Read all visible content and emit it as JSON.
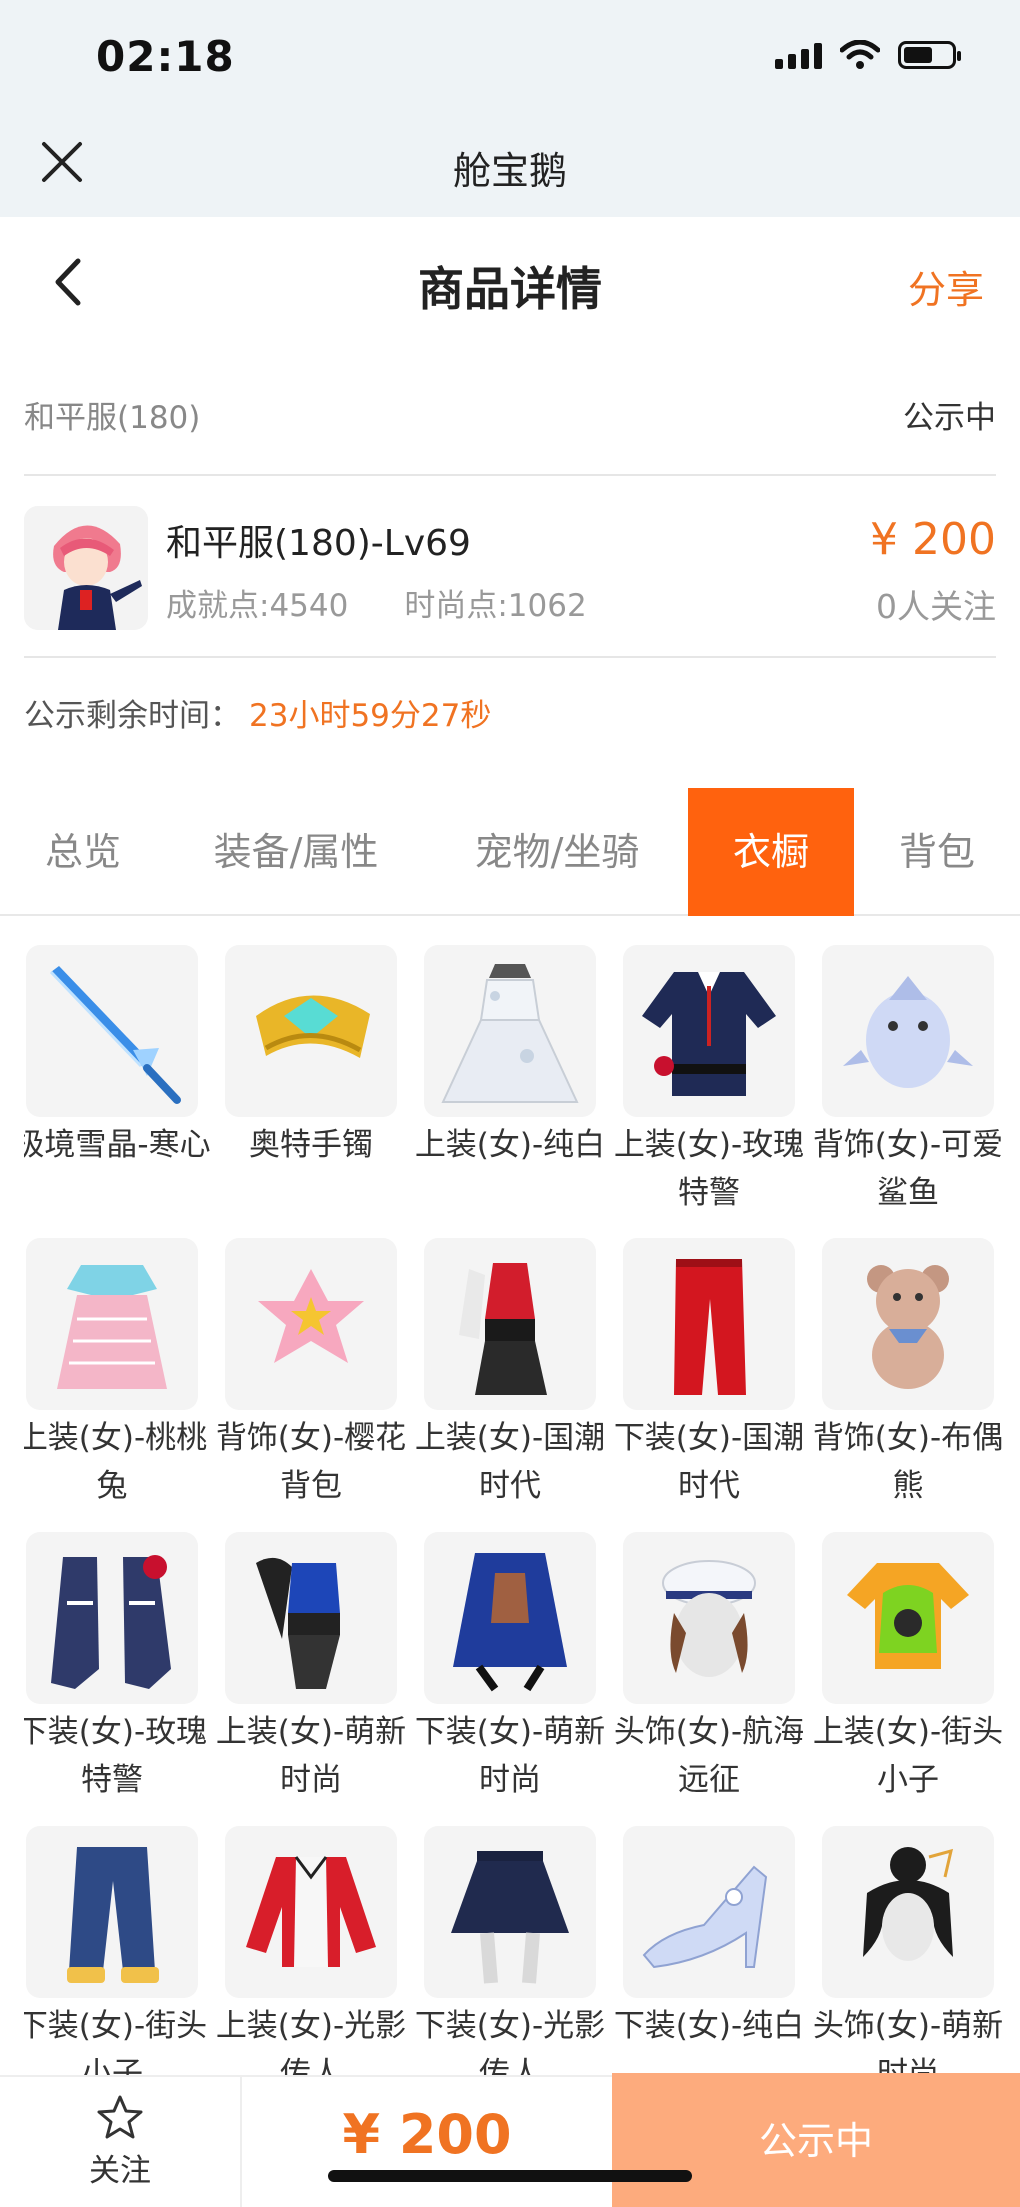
{
  "status_bar": {
    "time": "02:18",
    "battery_level": 0.6
  },
  "app": {
    "title": "舱宝鹅"
  },
  "header": {
    "title": "商品详情",
    "share_label": "分享"
  },
  "server_row": {
    "server": "和平服(180)",
    "state": "公示中"
  },
  "product": {
    "name": "和平服(180)-Lv69",
    "achievement": "成就点:4540",
    "fashion": "时尚点:1062",
    "price": "¥ 200",
    "followers": "0人关注"
  },
  "countdown": {
    "label": "公示剩余时间：",
    "value": "23小时59分27秒"
  },
  "tabs": [
    {
      "label": "总览",
      "active": false
    },
    {
      "label": "装备/属性",
      "active": false
    },
    {
      "label": "宠物/坐骑",
      "active": false
    },
    {
      "label": "衣橱",
      "active": true
    },
    {
      "label": "背包",
      "active": false
    }
  ],
  "wardrobe": [
    {
      "label": "极境雪晶-寒心",
      "icon": "ice-sword-icon"
    },
    {
      "label": "奥特手镯",
      "icon": "gold-bracelet-icon"
    },
    {
      "label": "上装(女)-纯白",
      "icon": "white-dress-icon"
    },
    {
      "label": "上装(女)-玫瑰特警",
      "icon": "police-jacket-icon"
    },
    {
      "label": "背饰(女)-可爱鲨鱼",
      "icon": "shark-backpack-icon"
    },
    {
      "label": "上装(女)-桃桃兔",
      "icon": "pink-dress-icon"
    },
    {
      "label": "背饰(女)-樱花背包",
      "icon": "sakura-bag-icon"
    },
    {
      "label": "上装(女)-国潮时代",
      "icon": "red-top-icon"
    },
    {
      "label": "下装(女)-国潮时代",
      "icon": "red-pants-icon"
    },
    {
      "label": "背饰(女)-布偶熊",
      "icon": "teddy-bear-icon"
    },
    {
      "label": "下装(女)-玫瑰特警",
      "icon": "boots-icon"
    },
    {
      "label": "上装(女)-萌新时尚",
      "icon": "blue-top-icon"
    },
    {
      "label": "下装(女)-萌新时尚",
      "icon": "blue-skirt-icon"
    },
    {
      "label": "头饰(女)-航海远征",
      "icon": "sailor-hat-icon"
    },
    {
      "label": "上装(女)-街头小子",
      "icon": "street-tee-icon"
    },
    {
      "label": "下装(女)-街头小子",
      "icon": "jeans-icon"
    },
    {
      "label": "上装(女)-光影传人",
      "icon": "red-jacket-icon"
    },
    {
      "label": "下装(女)-光影传人",
      "icon": "navy-skirt-icon"
    },
    {
      "label": "下装(女)-纯白",
      "icon": "heel-shoe-icon"
    },
    {
      "label": "头饰(女)-萌新时尚",
      "icon": "hair-bun-icon"
    }
  ],
  "bottom_bar": {
    "follow_label": "关注",
    "price": "¥ 200",
    "status_label": "公示中"
  },
  "colors": {
    "accent": "#f07322",
    "tab_active": "#ff620e",
    "status_button": "#fdab7d"
  }
}
